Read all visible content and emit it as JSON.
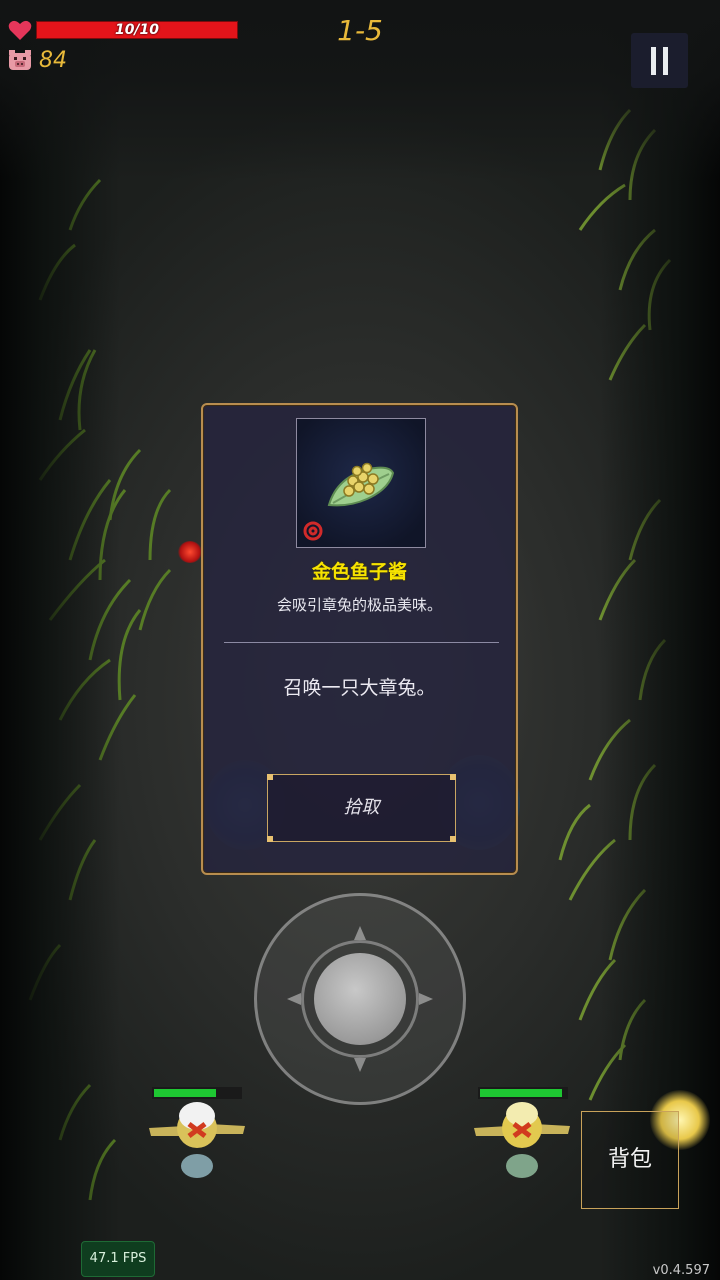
{
  "hud": {
    "hp_text": "10/10",
    "hp_fraction": 1.0,
    "coins": "84",
    "level": "1-5",
    "heart_icon": "heart-icon",
    "coin_icon": "pig-icon",
    "pause_icon": "pause-icon"
  },
  "item_dialog": {
    "name": "金色鱼子酱",
    "description": "会吸引章兔的极品美味。",
    "effect": "召唤一只大章兔。",
    "pickup_label": "拾取",
    "item_icon": "golden-caviar-icon"
  },
  "characters": [
    {
      "name": "left-minion",
      "hp_fraction": 0.72
    },
    {
      "name": "right-minion",
      "hp_fraction": 0.95
    }
  ],
  "bag_label": "背包",
  "fps": "47.1 FPS",
  "version": "v0.4.597",
  "colors": {
    "hp_red": "#e3141a",
    "gold_text": "#e8b93a",
    "item_name_yellow": "#f7e300",
    "dialog_border": "#b88d4f",
    "char_hp_green": "#1ec732"
  }
}
